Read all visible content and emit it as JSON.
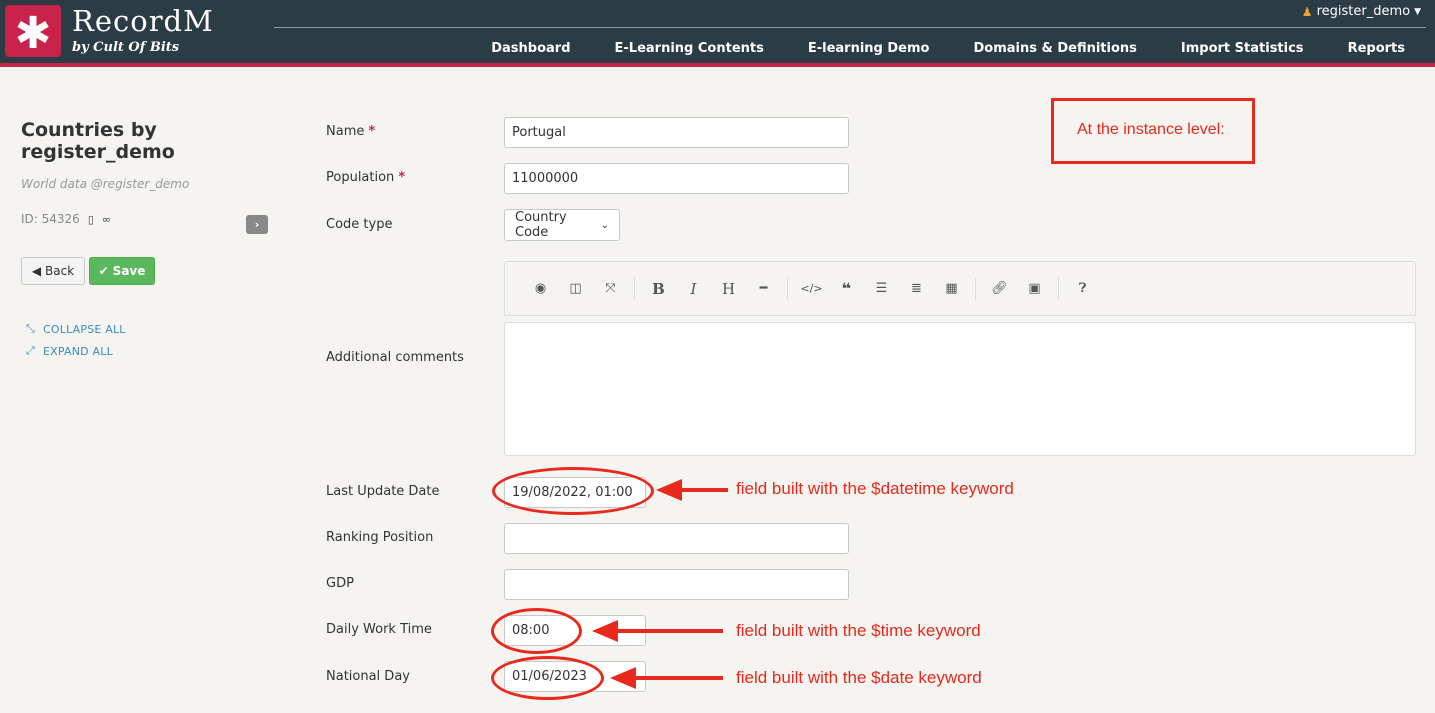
{
  "header": {
    "logo_glyph": "✱",
    "app_name": "RecordM",
    "app_tagline": "by Cult Of Bits",
    "user_name": "register_demo",
    "nav": [
      "Dashboard",
      "E-Learning Contents",
      "E-learning Demo",
      "Domains & Definitions",
      "Import Statistics",
      "Reports"
    ],
    "brand_color": "#c8234a",
    "bar_color": "#2c3c44"
  },
  "sidebar": {
    "title": "Countries by register_demo",
    "subtitle": "World data @register_demo",
    "id_label": "ID: 54326",
    "back_label": "Back",
    "save_label": "Save",
    "collapse_label": "COLLAPSE ALL",
    "expand_label": "EXPAND ALL"
  },
  "form": {
    "name": {
      "label": "Name",
      "value": "Portugal"
    },
    "population": {
      "label": "Population",
      "value": "11000000"
    },
    "code_type": {
      "label": "Code type",
      "value": "Country Code"
    },
    "comments": {
      "label": "Additional comments",
      "value": ""
    },
    "last_update": {
      "label": "Last Update Date",
      "value": "19/08/2022, 01:00"
    },
    "ranking": {
      "label": "Ranking Position",
      "value": ""
    },
    "gdp": {
      "label": "GDP",
      "value": ""
    },
    "work_time": {
      "label": "Daily Work Time",
      "value": "08:00"
    },
    "national_day": {
      "label": "National Day",
      "value": "01/06/2023"
    }
  },
  "editor_toolbar": [
    "eye-icon",
    "columns-icon",
    "fullscreen-icon",
    "bold-icon",
    "italic-icon",
    "heading-icon",
    "horizontal-rule-icon",
    "code-icon",
    "quote-icon",
    "unordered-list-icon",
    "ordered-list-icon",
    "table-icon",
    "link-icon",
    "image-icon",
    "help-icon"
  ],
  "annotations": {
    "instance_level": "At the instance level:",
    "datetime_note": "field built with the $datetime keyword",
    "time_note": "field built with the $time keyword",
    "date_note": "field built with the $date keyword",
    "color": "#e8291c"
  }
}
